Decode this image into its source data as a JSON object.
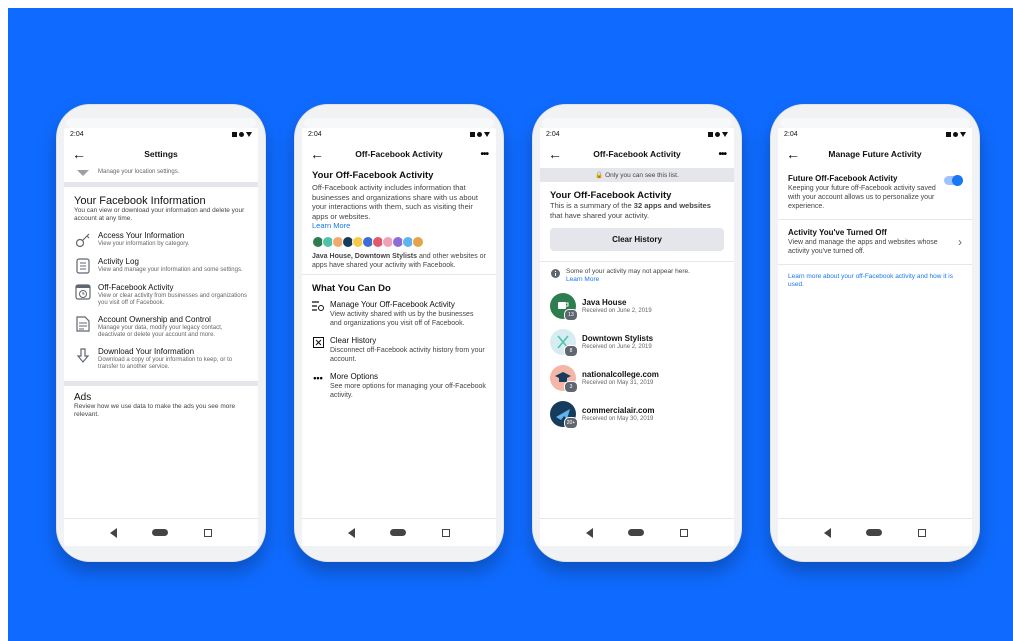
{
  "status_time": "2:04",
  "phone1": {
    "title": "Settings",
    "location_sub": "Manage your location settings.",
    "section_title": "Your Facebook Information",
    "section_desc": "You can view or download your information and delete your account at any time.",
    "items": [
      {
        "title": "Access Your Information",
        "sub": "View your information by category."
      },
      {
        "title": "Activity Log",
        "sub": "View and manage your information and some settings."
      },
      {
        "title": "Off-Facebook Activity",
        "sub": "View or clear activity from businesses and organizations you visit off of Facebook."
      },
      {
        "title": "Account Ownership and Control",
        "sub": "Manage your data, modify your legacy contact, deactivate or delete your account and more."
      },
      {
        "title": "Download Your Information",
        "sub": "Download a copy of your information to keep, or to transfer to another service."
      }
    ],
    "ads_title": "Ads",
    "ads_desc": "Review how we use data to make the ads you see more relevant."
  },
  "phone2": {
    "title": "Off-Facebook Activity",
    "heading": "Your Off-Facebook Activity",
    "desc": "Off-Facebook activity includes information that businesses and organizations share with us about your interactions with them, such as visiting their apps or websites.",
    "learn_more": "Learn More",
    "shared_bold": "Java House, Downtown Stylists",
    "shared_rest": " and other websites or apps have shared your activity with Facebook.",
    "what_title": "What You Can Do",
    "actions": [
      {
        "title": "Manage Your Off-Facebook Activity",
        "sub": "View activity shared with us by the businesses and organizations you visit off of Facebook."
      },
      {
        "title": "Clear History",
        "sub": "Disconnect off-Facebook activity history from your account."
      },
      {
        "title": "More Options",
        "sub": "See more options for managing your off-Facebook activity."
      }
    ]
  },
  "phone3": {
    "title": "Off-Facebook Activity",
    "only_you": "Only you can see this list.",
    "heading": "Your Off-Facebook Activity",
    "summary_a": "This is a summary of the ",
    "summary_b": "32 apps and websites",
    "summary_c": " that have shared your activity.",
    "clear_btn": "Clear History",
    "note": "Some of your activity may not appear here.",
    "learn_more": "Learn More",
    "list": [
      {
        "name": "Java House",
        "date": "Received on June 2, 2019",
        "badge": "13",
        "color": "#2e7d4f"
      },
      {
        "name": "Downtown Stylists",
        "date": "Received on June 2, 2019",
        "badge": "8",
        "color": "#d7ecf2"
      },
      {
        "name": "nationalcollege.com",
        "date": "Received on May 31, 2019",
        "badge": "3",
        "color": "#f4b6a6"
      },
      {
        "name": "commercialair.com",
        "date": "Received on May 30, 2019",
        "badge": "20+",
        "color": "#173b5c"
      }
    ]
  },
  "phone4": {
    "title": "Manage Future Activity",
    "future_title": "Future Off-Facebook Activity",
    "future_desc": "Keeping your future off-Facebook activity saved with your account allows us to personalize your experience.",
    "turned_title": "Activity You've Turned Off",
    "turned_desc": "View and manage the apps and websites whose activity you've turned off.",
    "learn_link": "Learn more about your off-Facebook activity and how it is used."
  }
}
